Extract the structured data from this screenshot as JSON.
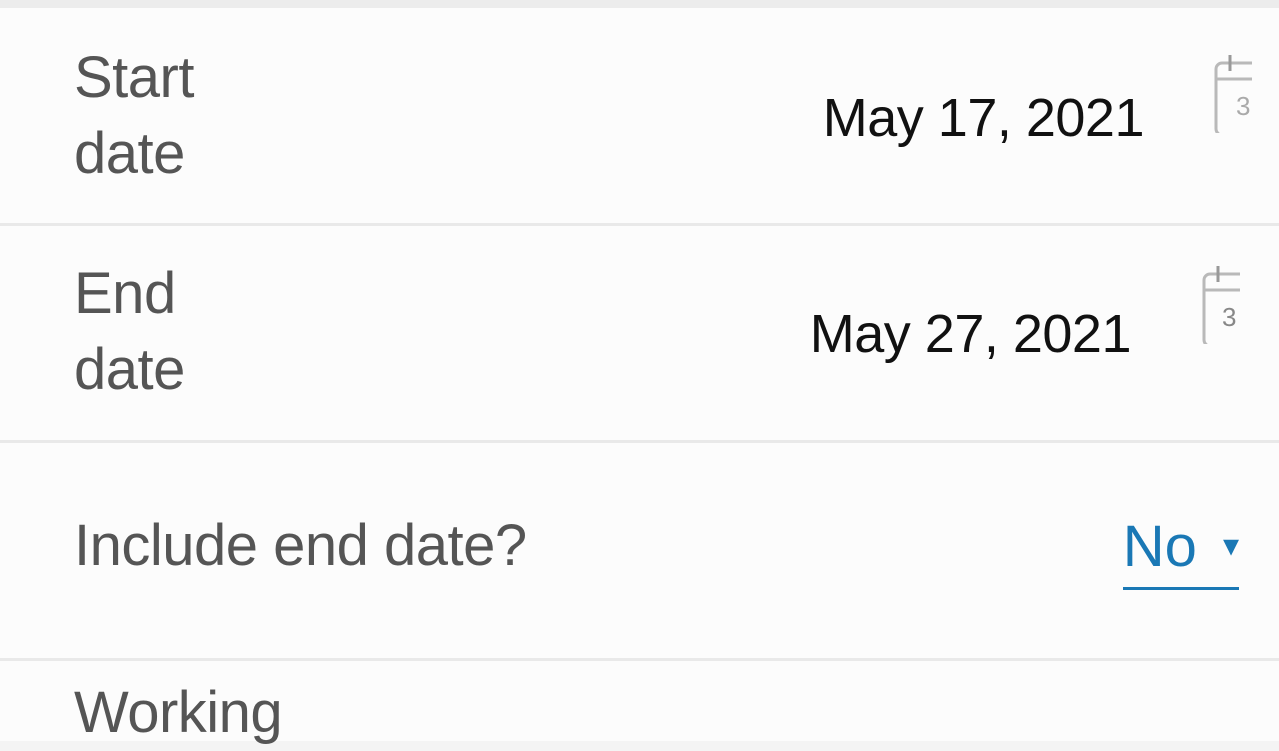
{
  "start_date": {
    "label": "Start date",
    "value": "May 17, 2021",
    "icon": "calendar-icon"
  },
  "end_date": {
    "label": "End date",
    "value": "May 27, 2021",
    "icon": "calendar-icon",
    "icon_text": "3"
  },
  "include_end_date": {
    "label": "Include end date?",
    "selected": "No",
    "arrow": "▾"
  },
  "working": {
    "label": "Working"
  },
  "colors": {
    "link": "#1a78b5",
    "label": "#555555",
    "value": "#111111"
  }
}
